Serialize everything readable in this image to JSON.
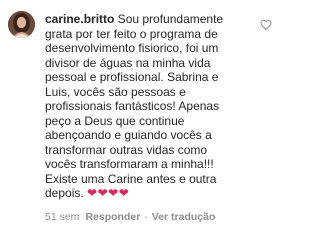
{
  "comment": {
    "username": "carine.britto",
    "text_lines": [
      " Sou profundamente",
      "grata por ter feito o programa de",
      "desenvolvimento fisiorico, foi um",
      "divisor de águas na minha vida",
      "pessoal e profissional. Sabrina e",
      "Luis, vocês são pessoas e",
      "profissionais fantásticos! Apenas",
      "peço a Deus que continue",
      "abençoando e guiando vocês a",
      "transformar outras vidas como",
      "vocês transformaram a minha!!!",
      "Existe uma Carine antes e outra",
      "depois. "
    ],
    "hearts": "❤❤❤❤",
    "time": "51 sem",
    "reply_label": "Responder",
    "separator": "·",
    "translate_label": "Ver tradução"
  },
  "colors": {
    "text": "#262626",
    "meta": "#8e8e8e",
    "heart": "#e0245e",
    "background": "#ffffff"
  },
  "icons": {
    "avatar": "profile-photo",
    "like": "heart-outline-icon"
  }
}
